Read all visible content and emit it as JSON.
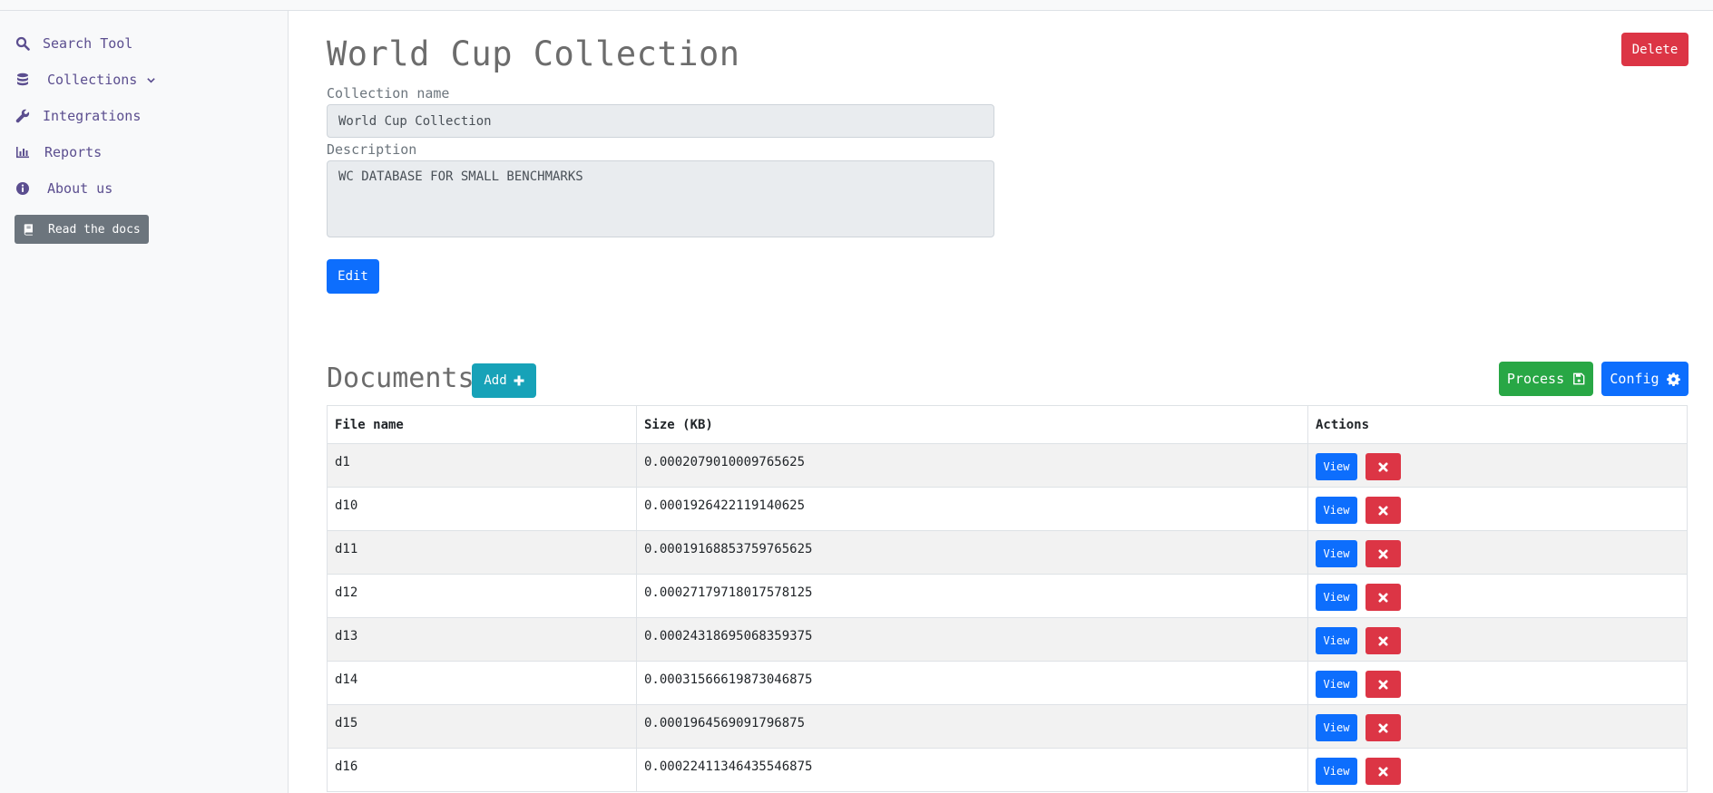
{
  "sidebar": {
    "items": [
      {
        "label": "Search Tool",
        "icon": "search-icon"
      },
      {
        "label": "Collections",
        "icon": "database-icon"
      },
      {
        "label": "Integrations",
        "icon": "wrench-icon"
      },
      {
        "label": "Reports",
        "icon": "bar-chart-icon"
      },
      {
        "label": "About us",
        "icon": "info-icon"
      }
    ],
    "docs_button": "Read the docs"
  },
  "collection": {
    "title": "World Cup Collection",
    "name_label": "Collection name",
    "name_value": "World Cup Collection",
    "description_label": "Description",
    "description_value": "WC DATABASE FOR SMALL BENCHMARKS",
    "edit_label": "Edit",
    "delete_label": "Delete"
  },
  "documents": {
    "title": "Documents",
    "add_label": "Add",
    "process_label": "Process",
    "config_label": "Config",
    "columns": [
      "File name",
      "Size (KB)",
      "Actions"
    ],
    "view_label": "View",
    "rows": [
      {
        "file": "d1",
        "size": "0.0002079010009765625"
      },
      {
        "file": "d10",
        "size": "0.0001926422119140625"
      },
      {
        "file": "d11",
        "size": "0.00019168853759765625"
      },
      {
        "file": "d12",
        "size": "0.0002717971801757 8125"
      },
      {
        "file": "d13",
        "size": "0.0002431869506835 9375"
      },
      {
        "file": "d14",
        "size": "0.0003156661987304 6875"
      },
      {
        "file": "d15",
        "size": "0.0001964569091796875"
      },
      {
        "file": "d16",
        "size": "0.00022411346435546875"
      }
    ]
  },
  "colors": {
    "primary": "#0d6efd",
    "danger": "#dc3545",
    "success": "#28a745",
    "info": "#17a2b8",
    "nav_text": "#5b4e8f"
  }
}
